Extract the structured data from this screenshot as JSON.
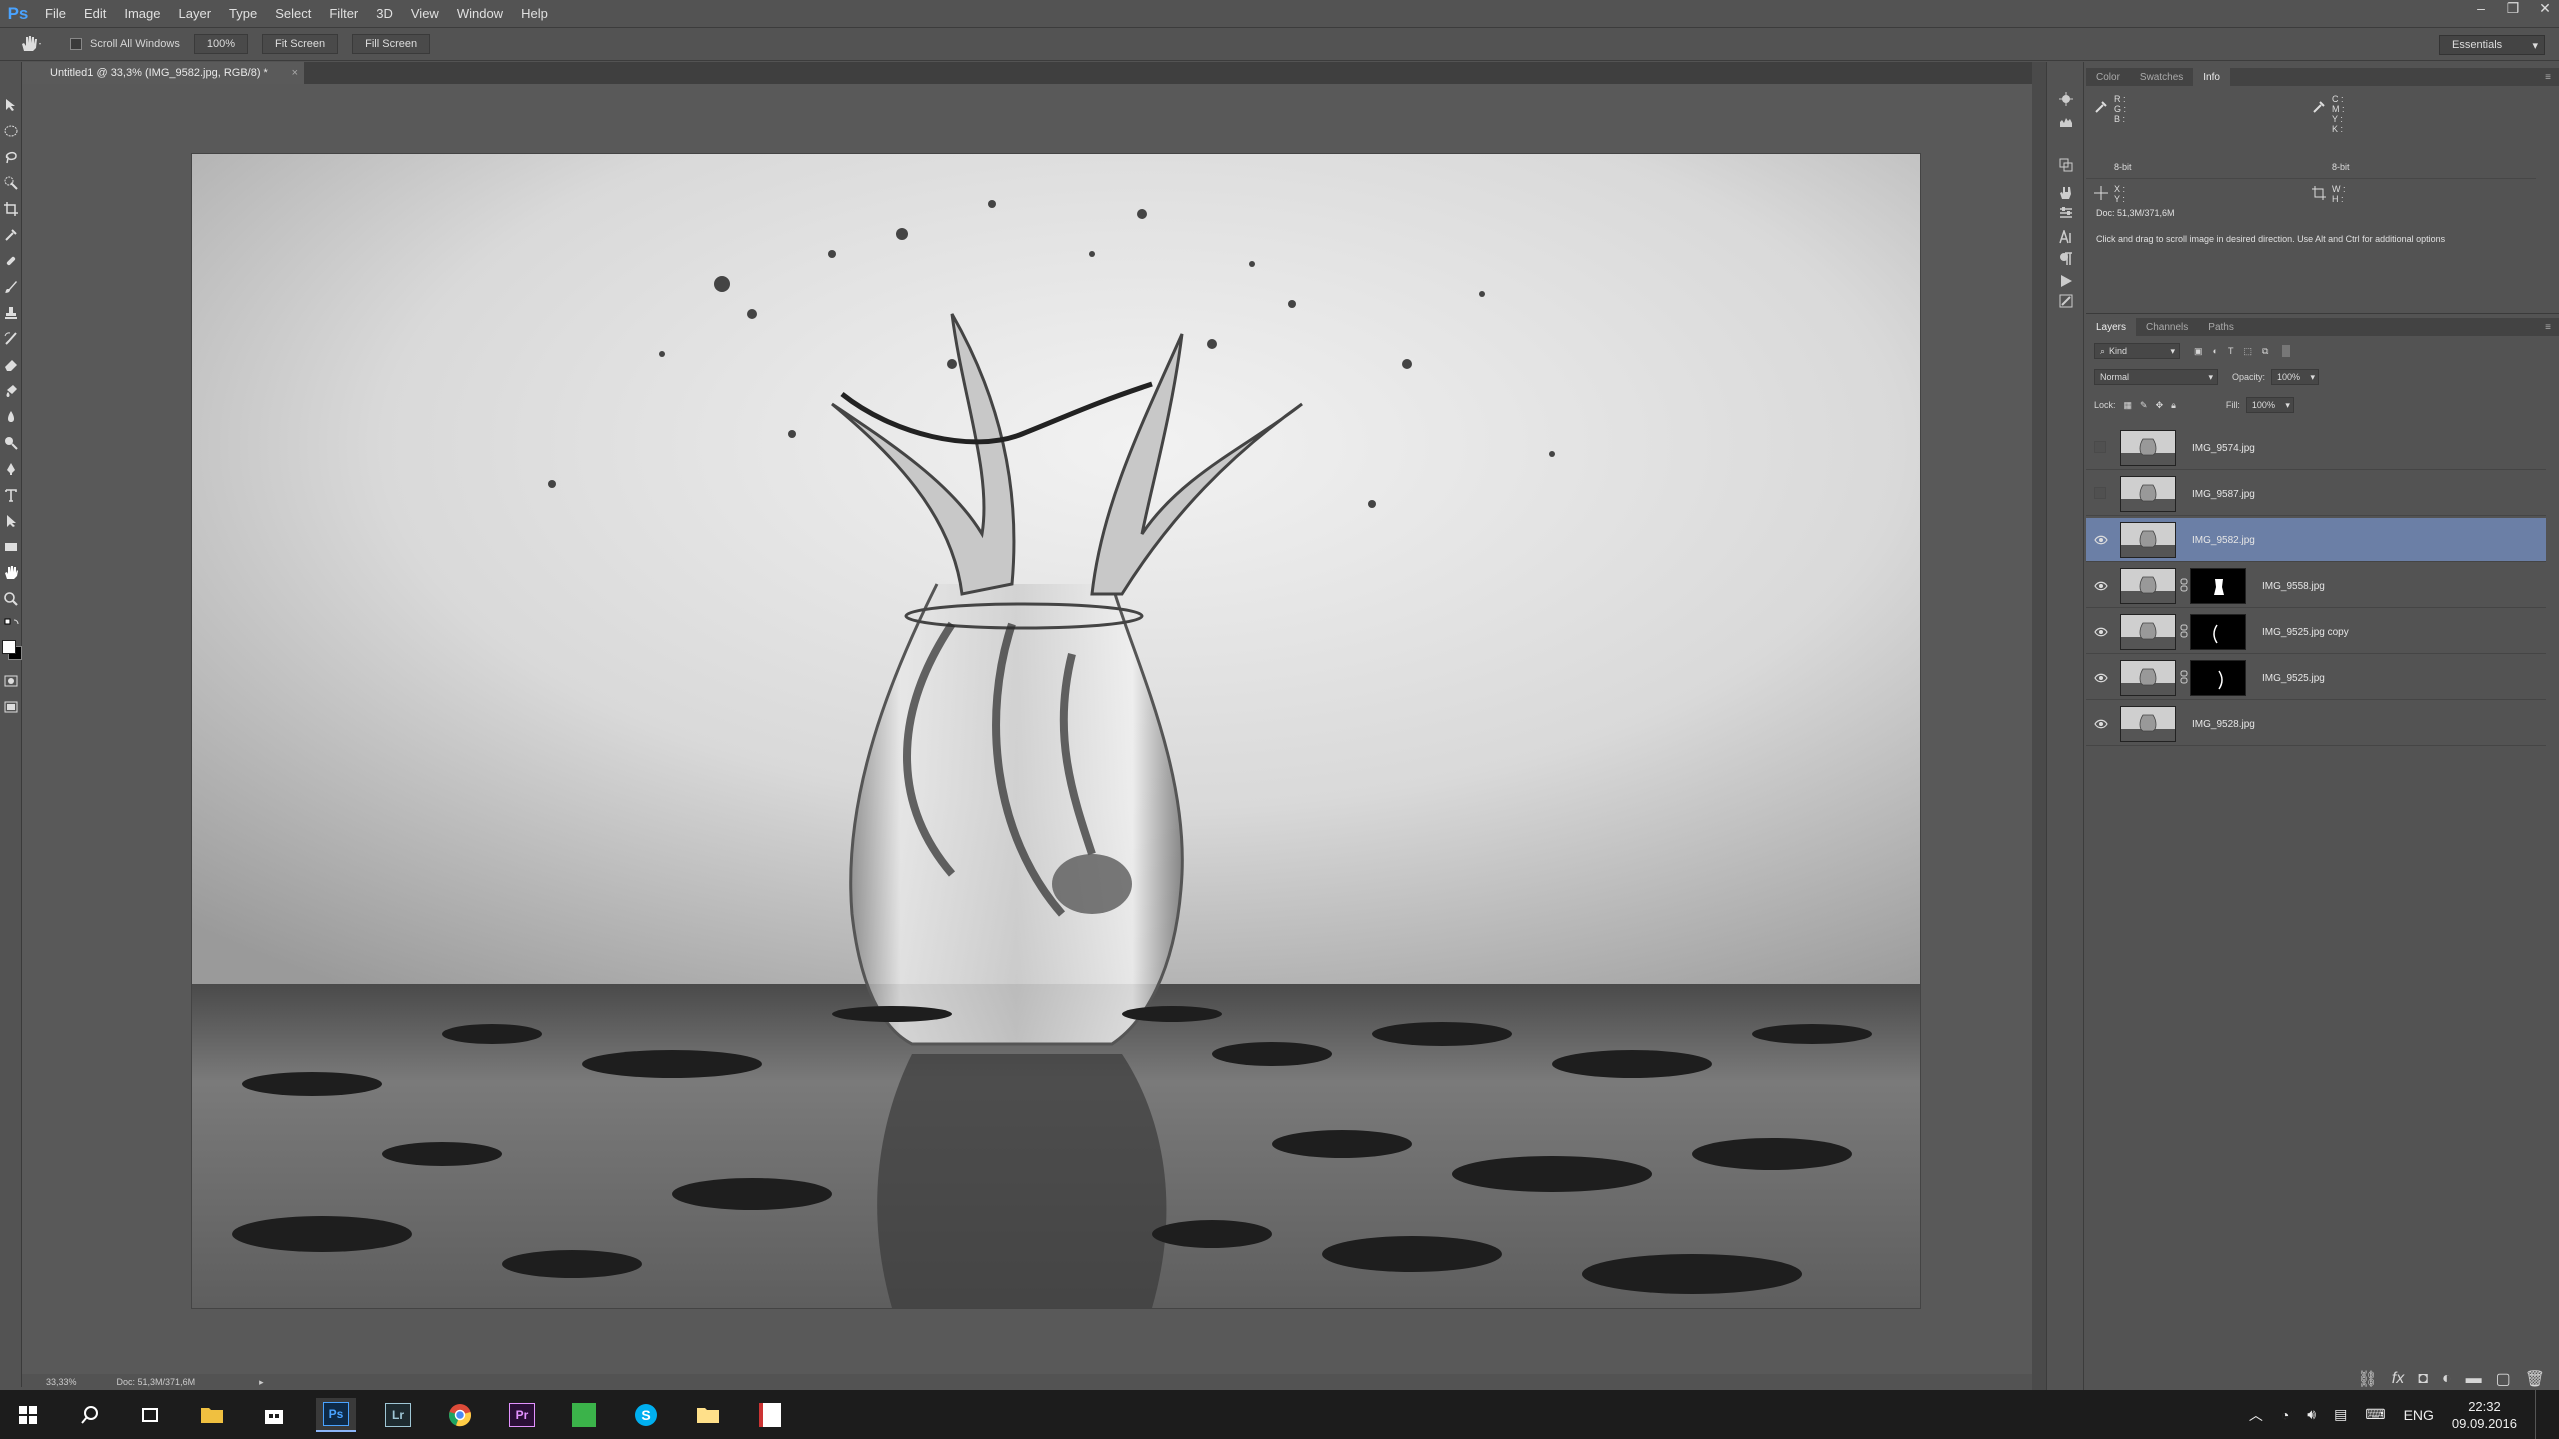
{
  "app": {
    "logo": "Ps"
  },
  "menu": [
    "File",
    "Edit",
    "Image",
    "Layer",
    "Type",
    "Select",
    "Filter",
    "3D",
    "View",
    "Window",
    "Help"
  ],
  "options": {
    "scroll_all_label": "Scroll All Windows",
    "zoom_btn": "100%",
    "fit_screen_btn": "Fit Screen",
    "fill_screen_btn": "Fill Screen",
    "workspace": "Essentials"
  },
  "document": {
    "tab_title": "Untitled1 @ 33,3% (IMG_9582.jpg, RGB/8) *",
    "close": "×"
  },
  "status": {
    "zoom": "33,33%",
    "doc_size": "Doc: 51,3M/371,6M"
  },
  "info_panel": {
    "tabs": [
      "Color",
      "Swatches",
      "Info"
    ],
    "active_tab": "Info",
    "rgb_labels": [
      "R :",
      "G :",
      "B :"
    ],
    "cmyk_labels": [
      "C :",
      "M :",
      "Y :",
      "K :"
    ],
    "bitdepth_left": "8-bit",
    "bitdepth_right": "8-bit",
    "xy_labels": [
      "X :",
      "Y :"
    ],
    "wh_labels": [
      "W :",
      "H :"
    ],
    "doc_size": "Doc: 51,3M/371,6M",
    "hint": "Click and drag to scroll image in desired direction.  Use Alt and Ctrl for additional options"
  },
  "layers_panel": {
    "tabs": [
      "Layers",
      "Channels",
      "Paths"
    ],
    "active_tab": "Layers",
    "filter_kind": "Kind",
    "blend_mode": "Normal",
    "opacity_label": "Opacity:",
    "opacity_value": "100%",
    "lock_label": "Lock:",
    "fill_label": "Fill:",
    "fill_value": "100%",
    "layers": [
      {
        "name": "IMG_9574.jpg",
        "visible": false,
        "selected": false,
        "mask": ""
      },
      {
        "name": "IMG_9587.jpg",
        "visible": false,
        "selected": false,
        "mask": ""
      },
      {
        "name": "IMG_9582.jpg",
        "visible": true,
        "selected": true,
        "mask": ""
      },
      {
        "name": "IMG_9558.jpg",
        "visible": true,
        "selected": false,
        "mask": "figure"
      },
      {
        "name": "IMG_9525.jpg copy",
        "visible": true,
        "selected": false,
        "mask": "left-curve"
      },
      {
        "name": "IMG_9525.jpg",
        "visible": true,
        "selected": false,
        "mask": "right-curve"
      },
      {
        "name": "IMG_9528.jpg",
        "visible": true,
        "selected": false,
        "mask": ""
      }
    ]
  },
  "taskbar": {
    "apps": [
      "start",
      "search",
      "task-view",
      "file-explorer",
      "store",
      "photoshop",
      "lightroom",
      "chrome",
      "premiere",
      "green-app",
      "skype",
      "folder",
      "document-app"
    ],
    "active_app": "photoshop",
    "tray_lang": "ENG",
    "time": "22:32",
    "date": "09.09.2016"
  },
  "colors": {
    "selection": "#6b7fa6",
    "ps_blue": "#4aa3ff"
  }
}
